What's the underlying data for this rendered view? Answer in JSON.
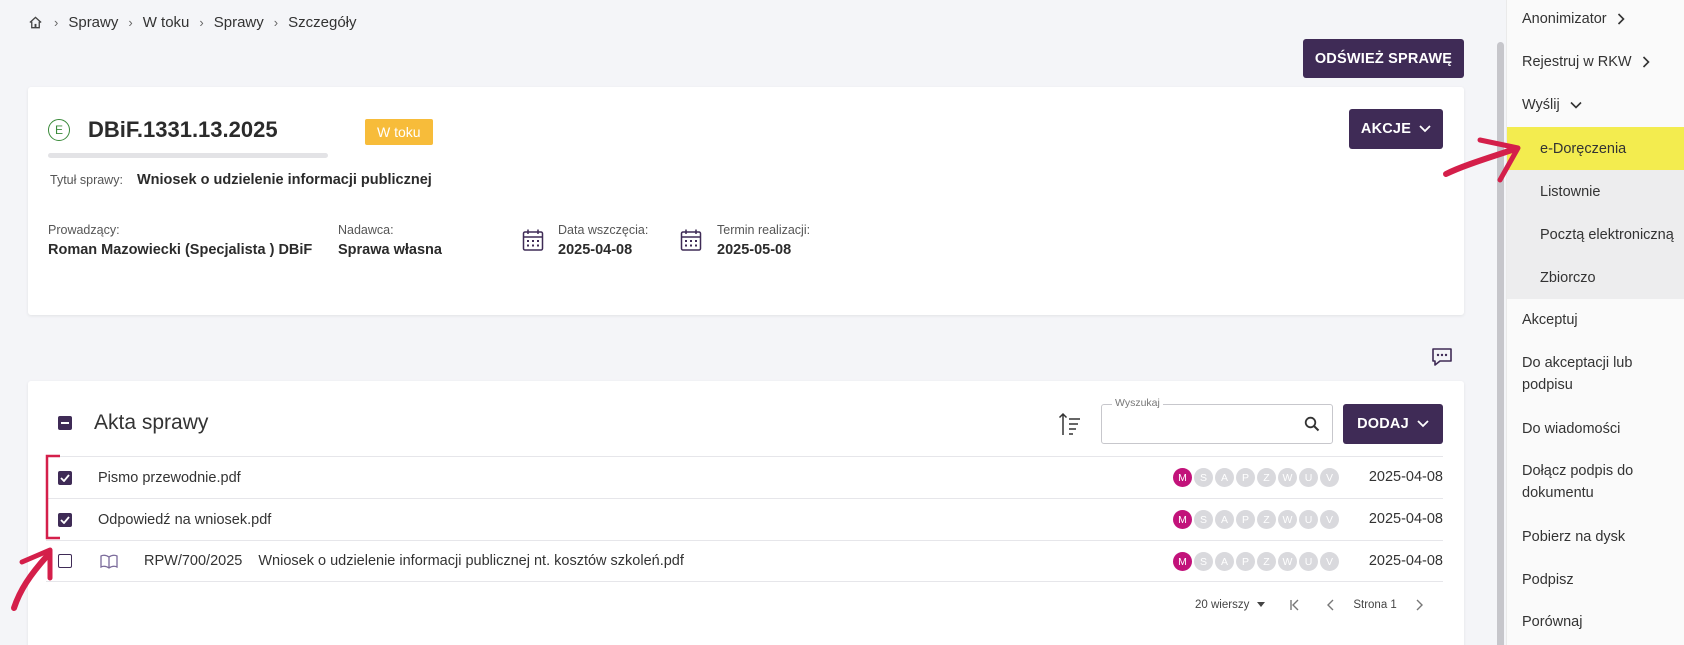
{
  "breadcrumb": {
    "items": [
      "Sprawy",
      "W toku",
      "Sprawy",
      "Szczegóły"
    ]
  },
  "header": {
    "refresh_label": "ODŚWIEŻ SPRAWĘ"
  },
  "case": {
    "prefix_icon_letter": "E",
    "number": "DBiF.1331.13.2025",
    "status": "W toku",
    "actions_label": "AKCJE",
    "title_label": "Tytuł sprawy:",
    "title_value": "Wniosek o udzielenie informacji publicznej",
    "fields": {
      "lead_label": "Prowadzący:",
      "lead_value": "Roman Mazowiecki (Specjalista ) DBiF",
      "sender_label": "Nadawca:",
      "sender_value": "Sprawa własna",
      "start_label": "Data wszczęcia:",
      "start_value": "2025-04-08",
      "deadline_label": "Termin realizacji:",
      "deadline_value": "2025-05-08"
    }
  },
  "files": {
    "title": "Akta sprawy",
    "search_legend": "Wyszukaj",
    "search_value": "",
    "add_label": "DODAJ",
    "badge_letters": [
      "M",
      "S",
      "A",
      "P",
      "Z",
      "W",
      "U",
      "V"
    ],
    "rows": [
      {
        "checked": true,
        "name": "Pismo przewodnie.pdf",
        "date": "2025-04-08"
      },
      {
        "checked": true,
        "name": "Odpowiedź na wniosek.pdf",
        "date": "2025-04-08"
      },
      {
        "checked": false,
        "rpw": "RPW/700/2025",
        "name": "Wniosek o udzielenie informacji publicznej nt. kosztów szkoleń.pdf",
        "date": "2025-04-08"
      }
    ],
    "pagination": {
      "rows_per_page": "20 wierszy",
      "page_label": "Strona 1"
    }
  },
  "side_menu": {
    "items": [
      {
        "label": "Anonimizator"
      },
      {
        "label": "Rejestruj w RKW"
      },
      {
        "label": "Wyślij"
      },
      {
        "label": "e-Doręczenia"
      },
      {
        "label": "Listownie"
      },
      {
        "label": "Pocztą elektroniczną"
      },
      {
        "label": "Zbiorczo"
      },
      {
        "label": "Akceptuj"
      },
      {
        "label": "Do akceptacji lub podpisu"
      },
      {
        "label": "Do wiadomości"
      },
      {
        "label": "Dołącz podpis do dokumentu"
      },
      {
        "label": "Pobierz na dysk"
      },
      {
        "label": "Podpisz"
      },
      {
        "label": "Porównaj"
      }
    ]
  },
  "colors": {
    "primary": "#3f2b56",
    "status_badge": "#f7bc3a",
    "badge_active": "#c2127a",
    "highlight": "#f3ec4f",
    "annotation": "#d41f4a"
  }
}
